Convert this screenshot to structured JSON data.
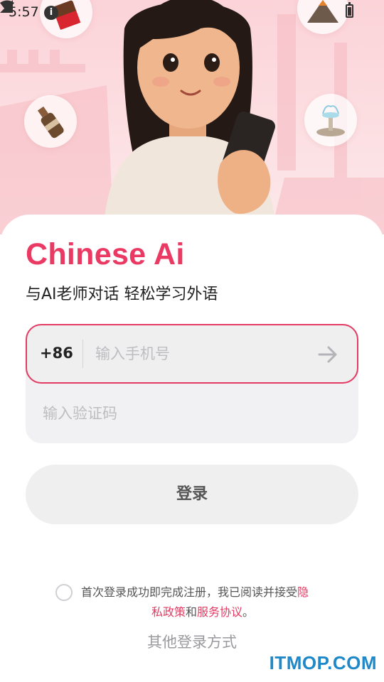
{
  "status_bar": {
    "time": "5:57",
    "info_icon": "info-icon",
    "wifi_icon": "wifi-icon",
    "signal_icon": "signal-icon",
    "battery_icon": "battery-icon"
  },
  "hero": {
    "illustration": "girl-holding-phone-illustration",
    "bubbles": [
      "chocolate-icon",
      "drink-bottle-icon",
      "fountain-icon",
      "mountain-icon"
    ]
  },
  "app": {
    "title": "Chinese Ai",
    "subtitle": "与AI老师对话 轻松学习外语",
    "accent_color": "#ea3a64"
  },
  "phone": {
    "country_code": "+86",
    "placeholder": "输入手机号",
    "value": "",
    "submit_icon": "arrow-right-icon"
  },
  "code": {
    "placeholder": "输入验证码",
    "value": ""
  },
  "login_button": {
    "label": "登录"
  },
  "agreement": {
    "text_before": "首次登录成功即完成注册，我已阅读并接受",
    "privacy_part1": "隐",
    "privacy_part2": "私政策",
    "conjunction": "和",
    "service_link": "服务协议",
    "period": "。",
    "checked": false
  },
  "other_login": {
    "label": "其他登录方式"
  },
  "watermark": {
    "text": "ITMOP.COM"
  }
}
